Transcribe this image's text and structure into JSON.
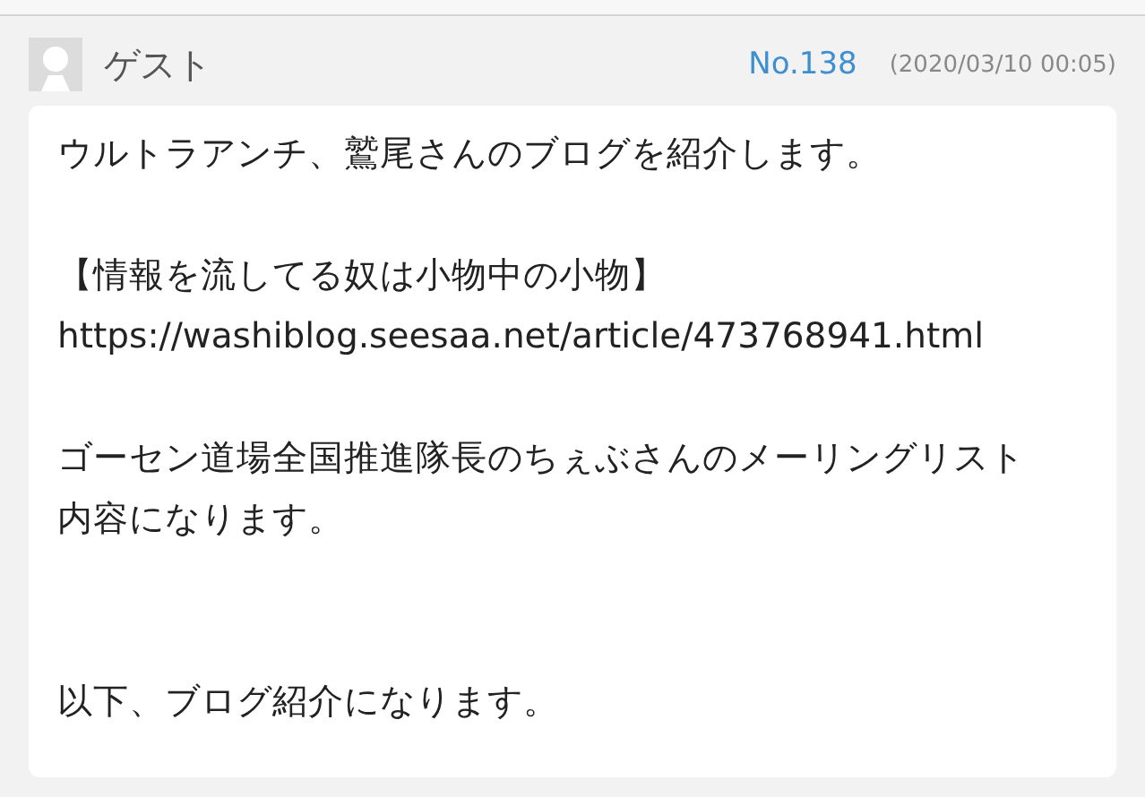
{
  "post": {
    "author": "ゲスト",
    "number": "No.138",
    "date": "(2020/03/10 00:05)",
    "paragraphs": [
      {
        "kind": "normal",
        "lines": [
          "ウルトラアンチ、鷲尾さんのブログを紹介します。"
        ]
      },
      {
        "kind": "normal",
        "lines": [
          "【情報を流してる奴は小物中の小物】",
          "https://washiblog.seesaa.net/article/473768941.html"
        ]
      },
      {
        "kind": "normal",
        "lines": [
          "ゴーセン道場全国推進隊長のちぇぶさんのメーリングリスト内容になります。"
        ]
      },
      {
        "kind": "after-break",
        "lines": [
          "以下、ブログ紹介になります。"
        ]
      }
    ]
  }
}
